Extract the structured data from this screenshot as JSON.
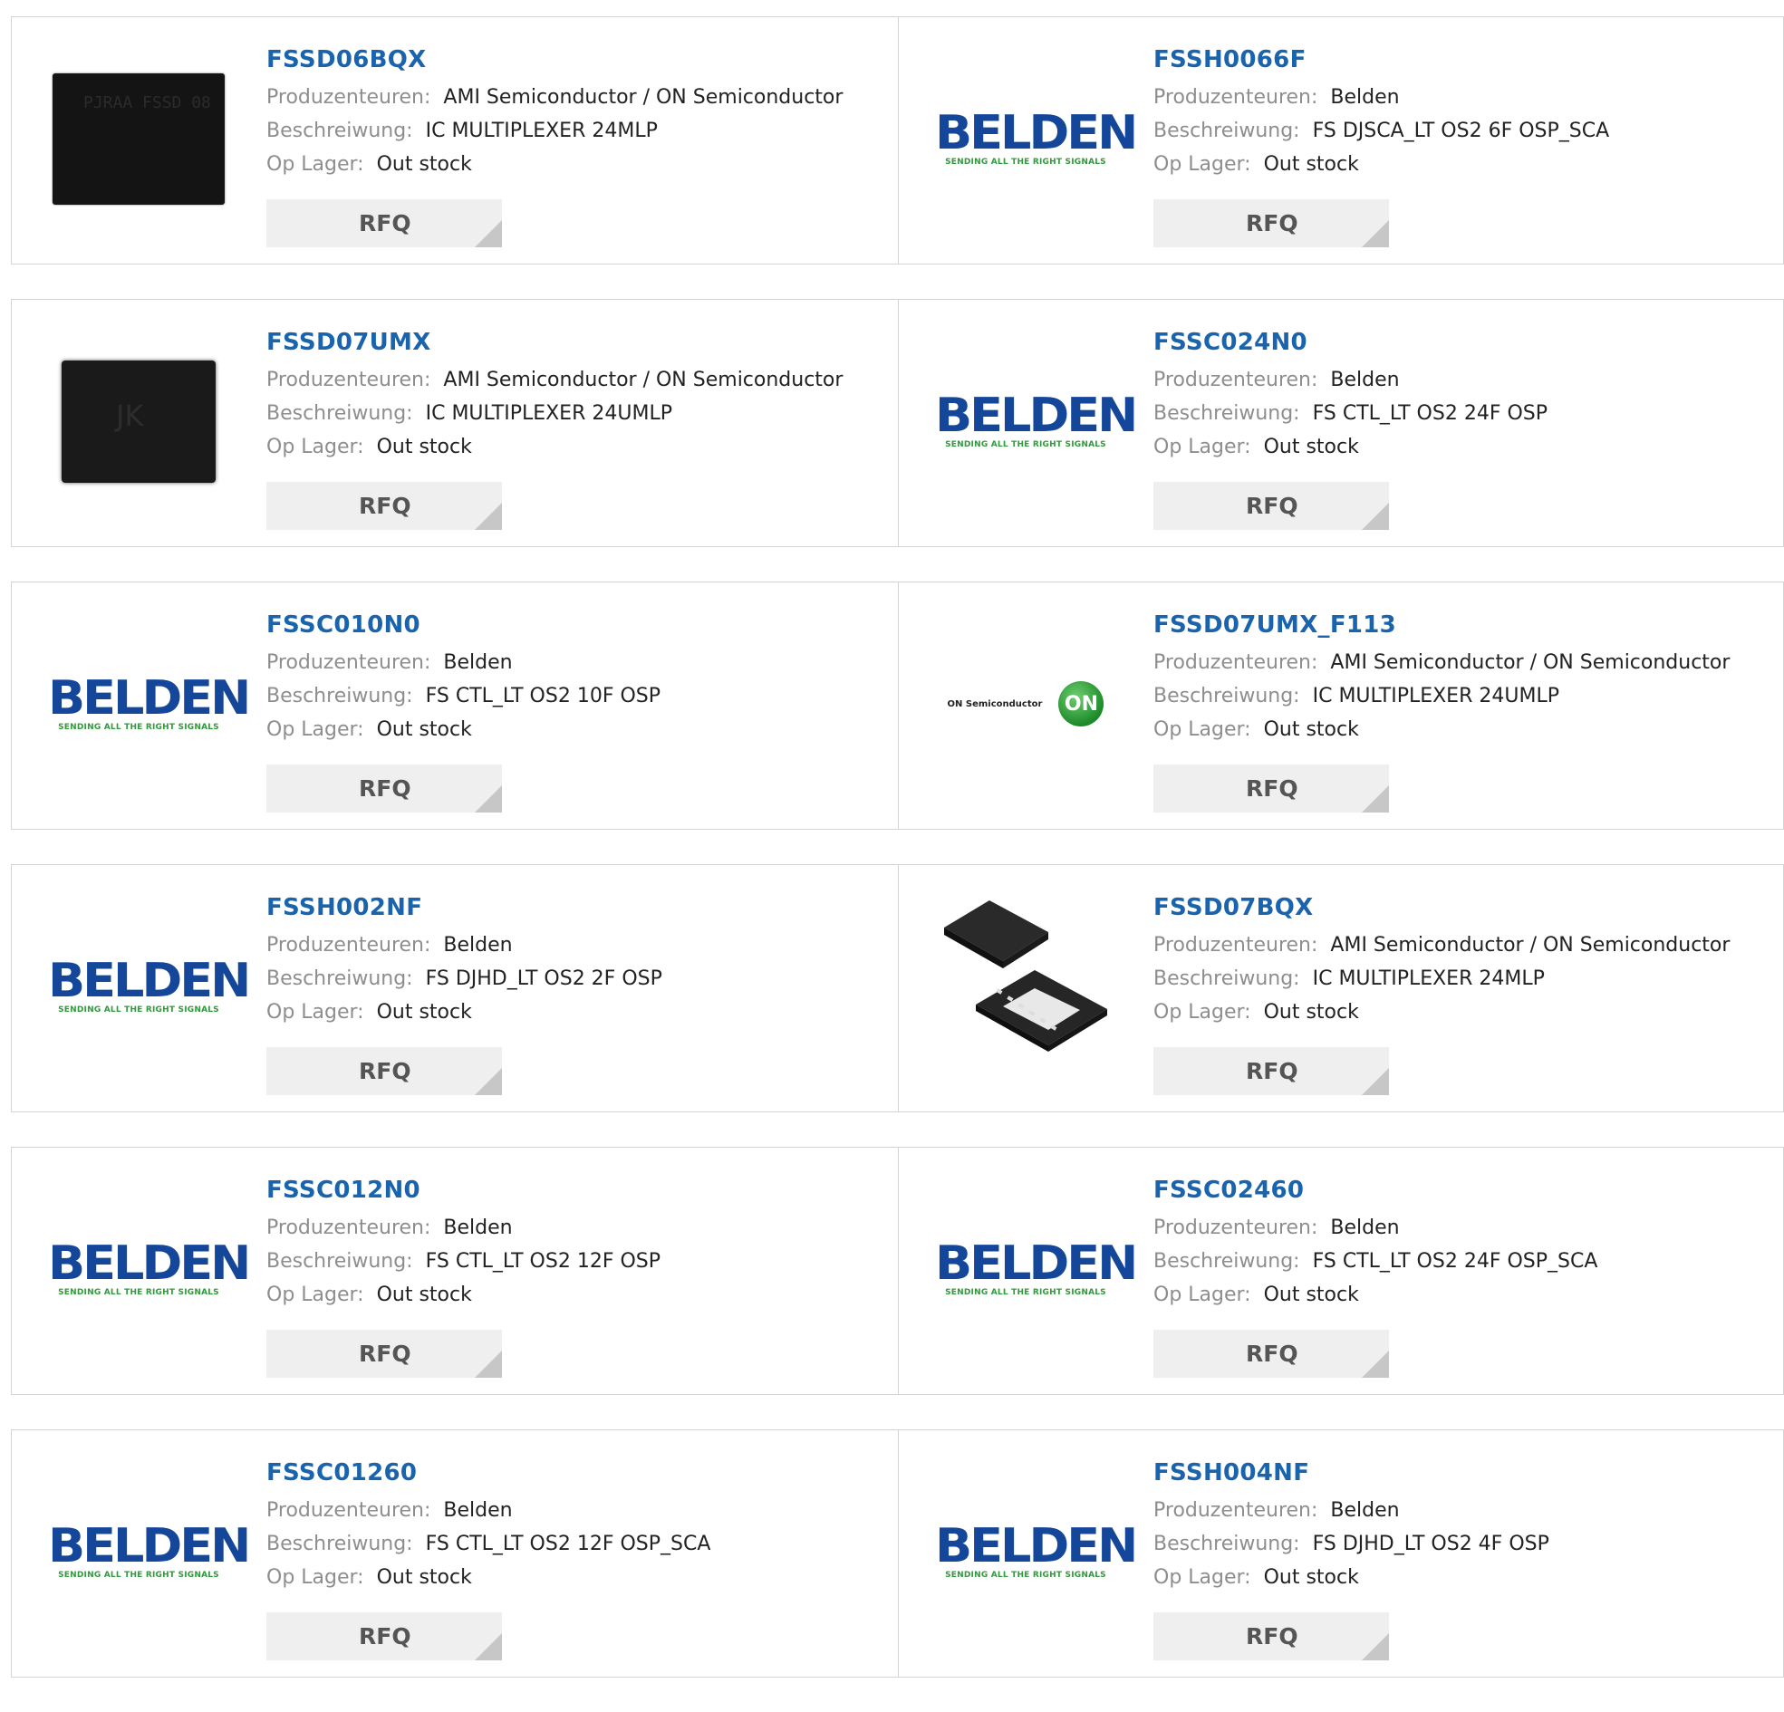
{
  "labels": {
    "manufacturer": "Produzenteuren:",
    "description": "Beschreiwung:",
    "stock": "Op Lager:",
    "rfq": "RFQ"
  },
  "logos": {
    "belden_word": "BELDEN",
    "belden_tagline": "SENDING ALL THE RIGHT SIGNALS",
    "onsemi_text": "ON Semiconductor",
    "onsemi_badge": "ON",
    "chip1_marking": "PJRAA FSSD 08",
    "chip2_marking": "JK"
  },
  "colors": {
    "part_link": "#1a63ad",
    "belden_blue": "#14479a",
    "belden_green": "#2f9b3a",
    "onsemi_green": "#1d8a2a"
  },
  "products": [
    {
      "part": "FSSD06BQX",
      "manufacturer": "AMI Semiconductor / ON Semiconductor",
      "description": "IC MULTIPLEXER 24MLP",
      "stock": "Out stock",
      "image": "chip-dark-marked"
    },
    {
      "part": "FSSH0066F",
      "manufacturer": "Belden",
      "description": "FS DJSCA_LT OS2 6F OSP_SCA",
      "stock": "Out stock",
      "image": "belden-logo"
    },
    {
      "part": "FSSD07UMX",
      "manufacturer": "AMI Semiconductor / ON Semiconductor",
      "description": "IC MULTIPLEXER 24UMLP",
      "stock": "Out stock",
      "image": "chip-dark-jk"
    },
    {
      "part": "FSSC024N0",
      "manufacturer": "Belden",
      "description": "FS CTL_LT OS2 24F OSP",
      "stock": "Out stock",
      "image": "belden-logo"
    },
    {
      "part": "FSSC010N0",
      "manufacturer": "Belden",
      "description": "FS CTL_LT OS2 10F OSP",
      "stock": "Out stock",
      "image": "belden-logo"
    },
    {
      "part": "FSSD07UMX_F113",
      "manufacturer": "AMI Semiconductor / ON Semiconductor",
      "description": "IC MULTIPLEXER 24UMLP",
      "stock": "Out stock",
      "image": "onsemi-logo"
    },
    {
      "part": "FSSH002NF",
      "manufacturer": "Belden",
      "description": "FS DJHD_LT OS2 2F OSP",
      "stock": "Out stock",
      "image": "belden-logo"
    },
    {
      "part": "FSSD07BQX",
      "manufacturer": "AMI Semiconductor / ON Semiconductor",
      "description": "IC MULTIPLEXER 24MLP",
      "stock": "Out stock",
      "image": "qfn-package"
    },
    {
      "part": "FSSC012N0",
      "manufacturer": "Belden",
      "description": "FS CTL_LT OS2 12F OSP",
      "stock": "Out stock",
      "image": "belden-logo"
    },
    {
      "part": "FSSC02460",
      "manufacturer": "Belden",
      "description": "FS CTL_LT OS2 24F OSP_SCA",
      "stock": "Out stock",
      "image": "belden-logo"
    },
    {
      "part": "FSSC01260",
      "manufacturer": "Belden",
      "description": "FS CTL_LT OS2 12F OSP_SCA",
      "stock": "Out stock",
      "image": "belden-logo"
    },
    {
      "part": "FSSH004NF",
      "manufacturer": "Belden",
      "description": "FS DJHD_LT OS2 4F OSP",
      "stock": "Out stock",
      "image": "belden-logo"
    }
  ]
}
